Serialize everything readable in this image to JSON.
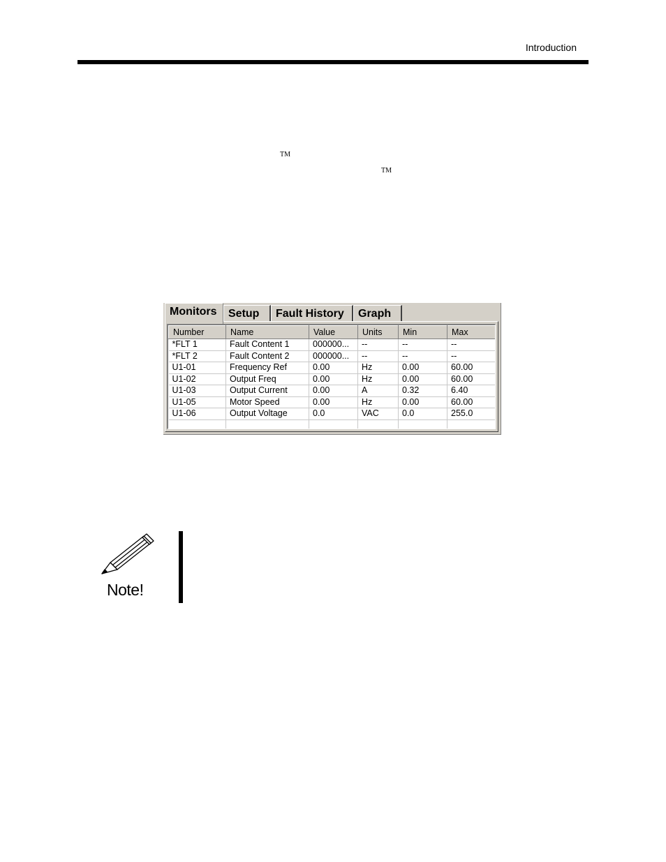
{
  "header": {
    "section_title": "Introduction"
  },
  "trademarks": {
    "tm1": "TM",
    "tm2": "TM"
  },
  "window": {
    "tabs": [
      {
        "label": "Monitors",
        "active": true
      },
      {
        "label": "Setup",
        "active": false
      },
      {
        "label": "Fault History",
        "active": false
      },
      {
        "label": "Graph",
        "active": false
      }
    ],
    "columns": [
      "Number",
      "Name",
      "Value",
      "Units",
      "Min",
      "Max"
    ],
    "rows": [
      [
        "*FLT 1",
        "Fault Content 1",
        "000000...",
        "--",
        "--",
        "--"
      ],
      [
        "*FLT 2",
        "Fault Content 2",
        "000000...",
        "--",
        "--",
        "--"
      ],
      [
        "U1-01",
        "Frequency Ref",
        "0.00",
        "Hz",
        "0.00",
        "60.00"
      ],
      [
        "U1-02",
        "Output Freq",
        "0.00",
        "Hz",
        "0.00",
        "60.00"
      ],
      [
        "U1-03",
        "Output Current",
        "0.00",
        "A",
        "0.32",
        "6.40"
      ],
      [
        "U1-05",
        "Motor Speed",
        "0.00",
        "Hz",
        "0.00",
        "60.00"
      ],
      [
        "U1-06",
        "Output Voltage",
        "0.0",
        "VAC",
        "0.0",
        "255.0"
      ],
      [
        "",
        "",
        "",
        "",
        "",
        ""
      ]
    ]
  },
  "note": {
    "label": "Note!",
    "icon": "pencil-icon"
  }
}
